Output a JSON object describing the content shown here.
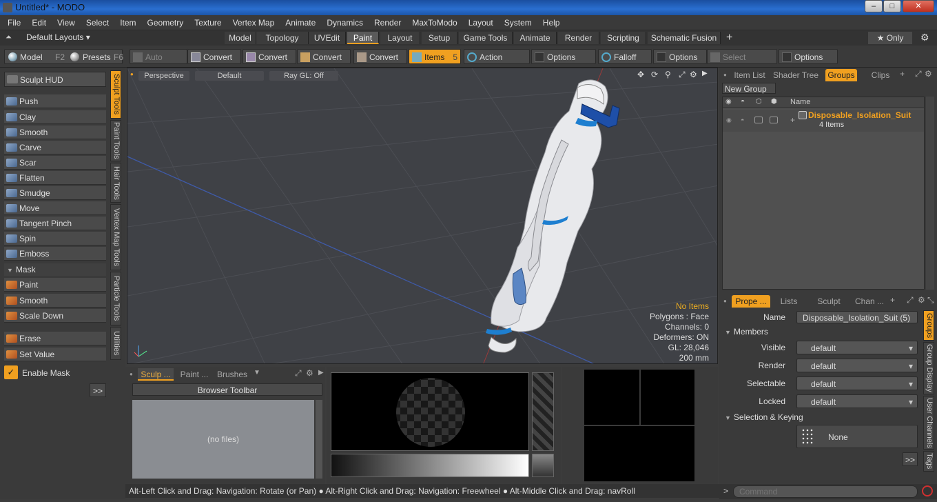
{
  "window": {
    "title": "Untitled* - MODO",
    "minimize": "–",
    "maximize": "□",
    "close": "✕"
  },
  "menu": [
    "File",
    "Edit",
    "View",
    "Select",
    "Item",
    "Geometry",
    "Texture",
    "Vertex Map",
    "Animate",
    "Dynamics",
    "Render",
    "MaxToModo",
    "Layout",
    "System",
    "Help"
  ],
  "layout_selector": "Default Layouts ▾",
  "layout_tabs": [
    "Model",
    "Topology",
    "UVEdit",
    "Paint",
    "Layout",
    "Setup",
    "Game Tools",
    "Animate",
    "Render",
    "Scripting",
    "Schematic Fusion"
  ],
  "active_layout_tab": "Paint",
  "add_tab": "+",
  "only_label": "★ Only",
  "toolbar": {
    "model": "Model",
    "model_key": "F2",
    "presets": "Presets",
    "presets_key": "F6",
    "auto_select": "Auto Select",
    "convert": "Convert",
    "items": "Items",
    "items_key": "5",
    "action_center": "Action Center",
    "options": "Options",
    "falloff": "Falloff",
    "select_through": "Select Through"
  },
  "left_panel": {
    "sculpt_hud": "Sculpt HUD",
    "tools": [
      "Push",
      "Clay",
      "Smooth",
      "Carve",
      "Scar",
      "Flatten",
      "Smudge",
      "Move",
      "Tangent Pinch",
      "Spin",
      "Emboss"
    ],
    "mask_header": "Mask",
    "mask_tools": [
      "Paint",
      "Smooth",
      "Scale Down"
    ],
    "extra_tools": [
      "Erase",
      "Set Value"
    ],
    "enable_mask": "Enable Mask",
    "more": ">>",
    "side_tabs": [
      "Sculpt Tools",
      "Paint Tools",
      "Hair Tools",
      "Vertex Map Tools",
      "Particle Tools",
      "Utilities"
    ]
  },
  "viewport": {
    "perspective": "Perspective",
    "default": "Default",
    "ray_gl": "Ray GL: Off",
    "info": {
      "items": "No Items",
      "polygons": "Polygons : Face",
      "channels": "Channels: 0",
      "deformers": "Deformers: ON",
      "gl": "GL: 28,046",
      "size": "200 mm"
    }
  },
  "bottom_left": {
    "tabs": [
      "Sculp ...",
      "Paint ...",
      "Brushes"
    ],
    "browser_toolbar": "Browser Toolbar",
    "no_files": "(no files)"
  },
  "right_panel": {
    "tabs": [
      "Item List",
      "Shader Tree",
      "Groups",
      "Clips"
    ],
    "active_tab": "Groups",
    "new_group": "New Group",
    "name_header": "Name",
    "group_name": "Disposable_Isolation_Suit",
    "group_count": "4 Items",
    "prop_tabs": [
      "Prope ...",
      "Lists",
      "Sculpt",
      "Chan ..."
    ],
    "name_label": "Name",
    "name_value": "Disposable_Isolation_Suit (5)",
    "members_header": "Members",
    "props": [
      {
        "label": "Visible",
        "value": "default"
      },
      {
        "label": "Render",
        "value": "default"
      },
      {
        "label": "Selectable",
        "value": "default"
      },
      {
        "label": "Locked",
        "value": "default"
      }
    ],
    "selection_header": "Selection & Keying",
    "none_label": "None",
    "more": ">>",
    "side_tabs": [
      "Groups",
      "Group Display",
      "User Channels",
      "Tags"
    ]
  },
  "status": "Alt-Left Click and Drag: Navigation: Rotate (or Pan) ● Alt-Right Click and Drag: Navigation: Freewheel ● Alt-Middle Click and Drag: navRoll",
  "command_placeholder": "Command",
  "colors": {
    "accent": "#f0a020",
    "suit_trim": "#1e7fd0",
    "glove": "#5b86c4"
  }
}
